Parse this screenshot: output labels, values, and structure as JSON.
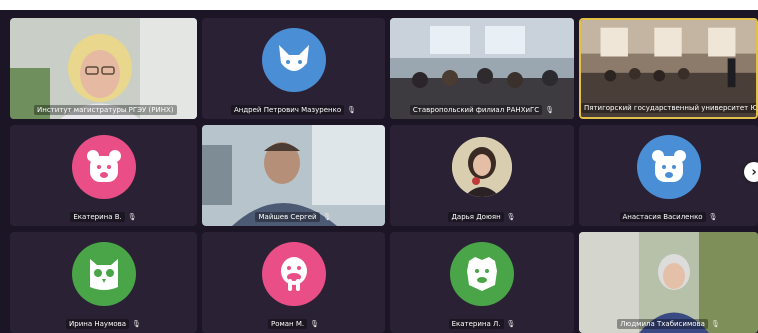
{
  "participants": [
    {
      "name": "Институт магистратуры РГЭУ (РИНХ)",
      "type": "video"
    },
    {
      "name": "Андрей Петрович Мазуренко",
      "type": "avatar",
      "icon": "fox-icon",
      "color": "#4a8fd6"
    },
    {
      "name": "Ставропольский филиал РАНХиГС",
      "type": "video"
    },
    {
      "name": "Пятигорский государственный университет Юриди...",
      "type": "video",
      "speaking": true
    },
    {
      "name": "Екатерина В.",
      "type": "avatar",
      "icon": "bear-icon",
      "color": "#e94f86"
    },
    {
      "name": "Майшев Сергей",
      "type": "video"
    },
    {
      "name": "Дарья Доюян",
      "type": "photo"
    },
    {
      "name": "Анастасия Василенко",
      "type": "avatar",
      "icon": "bear-icon",
      "color": "#4a8fd6"
    },
    {
      "name": "Ирина Наумова",
      "type": "avatar",
      "icon": "owl-icon",
      "color": "#4aa548"
    },
    {
      "name": "Роман М.",
      "type": "avatar",
      "icon": "walrus-icon",
      "color": "#e94f86"
    },
    {
      "name": "Екатерина Л.",
      "type": "avatar",
      "icon": "lion-icon",
      "color": "#4aa548"
    },
    {
      "name": "Людмила Тхабисимова",
      "type": "video"
    }
  ],
  "controls": {
    "next_page": "›"
  }
}
